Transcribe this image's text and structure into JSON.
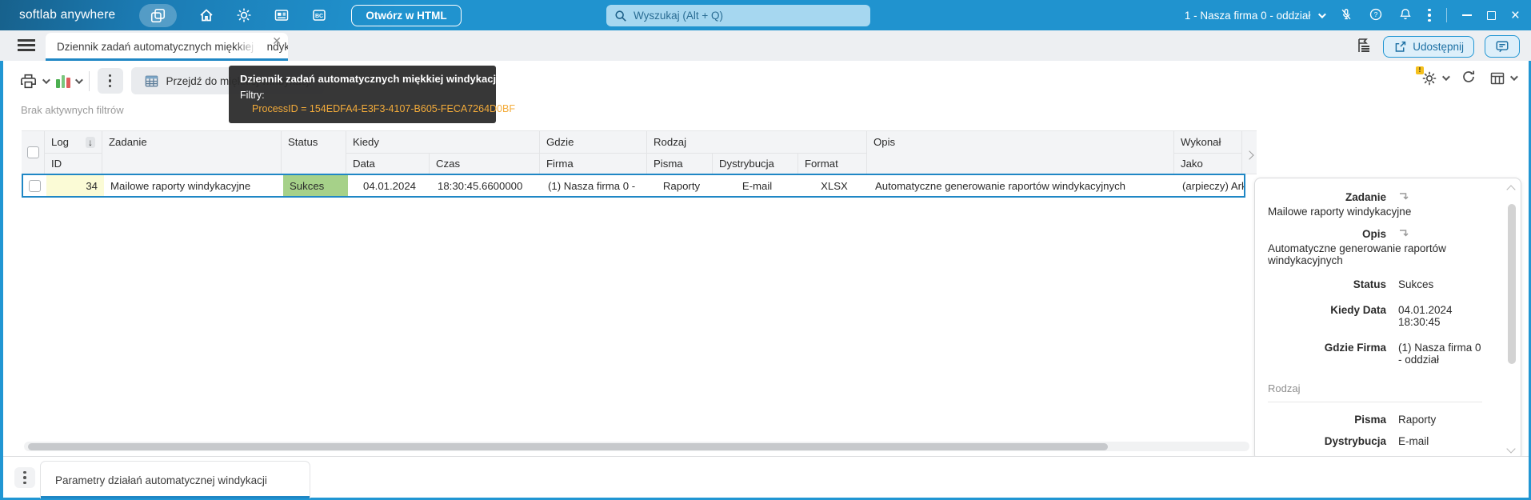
{
  "header": {
    "brand": "softlab anywhere",
    "open_html_button": "Otwórz w HTML",
    "search_placeholder": "Wyszukaj (Alt + Q)",
    "company_selector": "1 - Nasza firma 0 - oddział"
  },
  "tab_bar": {
    "active_tab": "Dziennik zadań automatycznych miękkiej windykacji",
    "share_button": "Udostępnij"
  },
  "toolbar": {
    "goto_button": "Przejdź do miękkiej windykacji",
    "filters_status": "Brak aktywnych filtrów"
  },
  "tooltip": {
    "title": "Dziennik zadań automatycznych miękkiej windykacji",
    "filters_label": "Filtry:",
    "filter_line": "ProcessID = 154EDFA4-E3F3-4107-B605-FECA7264D0BF"
  },
  "table": {
    "headers": {
      "log": "Log",
      "id": "ID",
      "zadanie": "Zadanie",
      "status": "Status",
      "kiedy": "Kiedy",
      "data": "Data",
      "czas": "Czas",
      "gdzie": "Gdzie",
      "firma": "Firma",
      "rodzaj": "Rodzaj",
      "pisma": "Pisma",
      "dystrybucja": "Dystrybucja",
      "format": "Format",
      "opis": "Opis",
      "wykonal": "Wykonał",
      "jako": "Jako"
    },
    "sort_icon": "↓",
    "row": {
      "id": "34",
      "zadanie": "Mailowe raporty windykacyjne",
      "status": "Sukces",
      "data": "04.01.2024",
      "czas": "18:30:45.6600000",
      "firma": "(1) Nasza firma 0 -",
      "pisma": "Raporty",
      "dystrybucja": "E-mail",
      "format": "XLSX",
      "opis": "Automatyczne generowanie raportów windykacyjnych",
      "jako": "(arpieczy) Ark"
    }
  },
  "detail_panel": {
    "fields": [
      {
        "label": "Zadanie",
        "value": "Mailowe raporty windykacyjne"
      },
      {
        "label": "Opis",
        "value": "Automatyczne generowanie raportów windykacyjnych"
      },
      {
        "label": "Status",
        "value": "Sukces"
      },
      {
        "label": "Kiedy Data",
        "value": "04.01.2024 18:30:45"
      },
      {
        "label": "Gdzie Firma",
        "value": "(1) Nasza firma 0 - oddział"
      }
    ],
    "section_label": "Rodzaj",
    "section_fields": [
      {
        "label": "Pisma",
        "value": "Raporty"
      },
      {
        "label": "Dystrybucja",
        "value": "E-mail"
      }
    ]
  },
  "bottom_bar": {
    "active_tab": "Parametry działań automatycznej windykacji"
  },
  "colors": {
    "header_blue": "#2093cf",
    "accent_blue": "#1f87c5",
    "success_green": "#a6d189",
    "filter_amber": "#f3ab3a",
    "id_cell_yellow": "#fbfbd6"
  }
}
